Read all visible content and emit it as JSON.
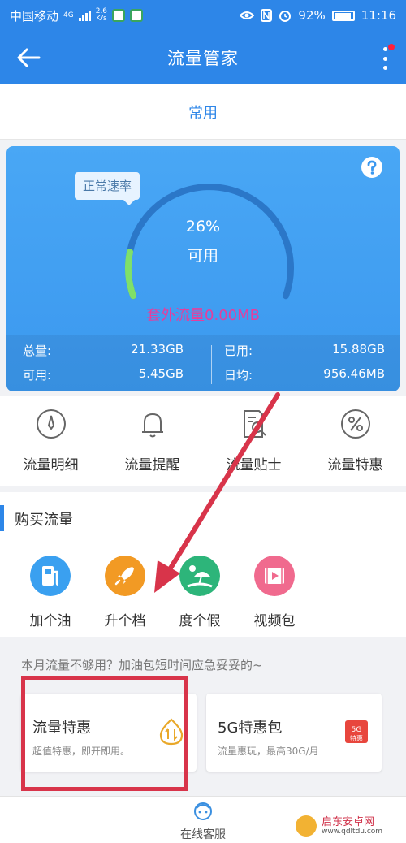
{
  "status": {
    "carrier": "中国移动",
    "net_type": "4G",
    "speed": "2.6",
    "speed_unit": "K/s",
    "battery": "92%",
    "time": "11:16"
  },
  "header": {
    "title": "流量管家"
  },
  "tabs": [
    {
      "label": "常用"
    }
  ],
  "usage": {
    "speed_tag": "正常速率",
    "percent": "26%",
    "available_label": "可用",
    "percent_value": 26,
    "extra_traffic": "套外流量0.00MB",
    "stats": {
      "total_label": "总量:",
      "total_value": "21.33GB",
      "used_label": "已用:",
      "used_value": "15.88GB",
      "avail_label": "可用:",
      "avail_value": "5.45GB",
      "daily_label": "日均:",
      "daily_value": "956.46MB"
    }
  },
  "features": [
    {
      "label": "流量明细",
      "icon": "compass-icon"
    },
    {
      "label": "流量提醒",
      "icon": "bell-icon"
    },
    {
      "label": "流量贴士",
      "icon": "document-search-icon"
    },
    {
      "label": "流量特惠",
      "icon": "percent-icon"
    }
  ],
  "buy": {
    "title": "购买流量",
    "packs": [
      {
        "label": "加个油",
        "icon": "fuel-pump-icon",
        "color": "#3aa0f0"
      },
      {
        "label": "升个档",
        "icon": "rocket-icon",
        "color": "#f29a24"
      },
      {
        "label": "度个假",
        "icon": "beach-icon",
        "color": "#2db57a"
      },
      {
        "label": "视频包",
        "icon": "video-icon",
        "color": "#f06a8e"
      }
    ]
  },
  "tip": {
    "text": "本月流量不够用？加油包短时间应急妥妥的~"
  },
  "offers": [
    {
      "title": "流量特惠",
      "subtitle": "超值特惠，即开即用。",
      "icon": "data-transfer-icon"
    },
    {
      "title": "5G特惠包",
      "subtitle": "流量惠玩，最高30G/月",
      "icon": "5g-gift-icon",
      "badge_top": "5G",
      "badge_bottom": "特惠"
    }
  ],
  "bottom": {
    "service_label": "在线客服"
  },
  "watermark": {
    "name": "启东安卓网",
    "url": "www.qdltdu.com"
  }
}
